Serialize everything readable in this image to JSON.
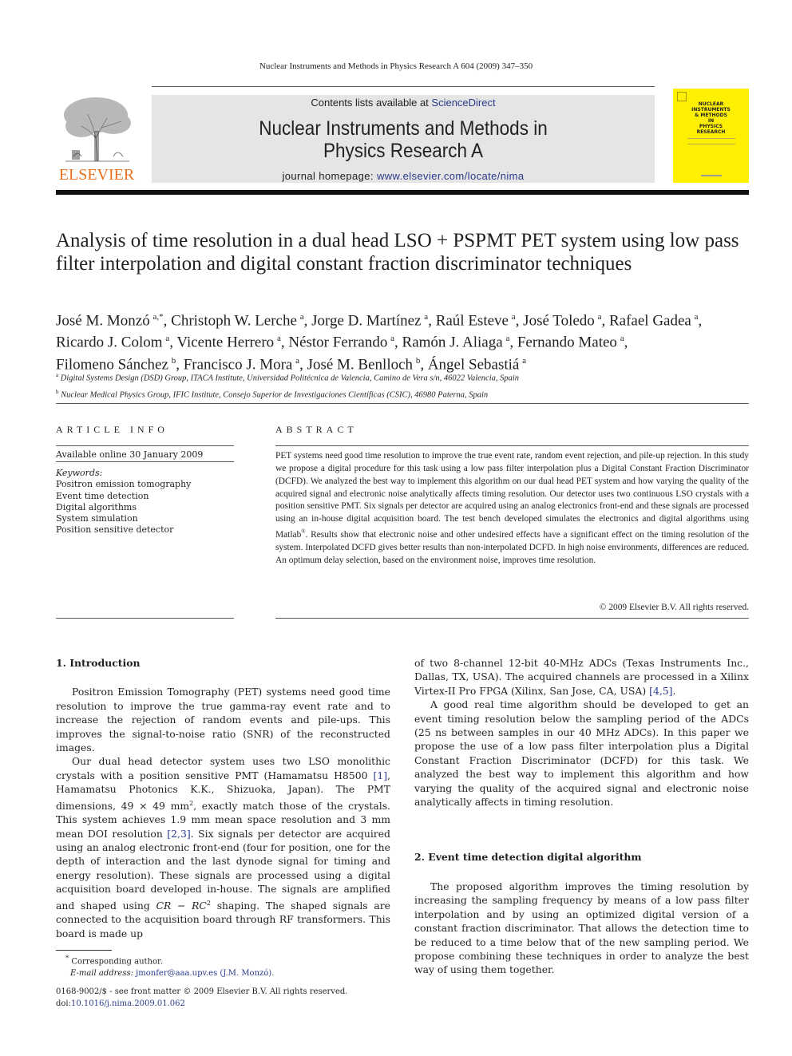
{
  "running_head": "Nuclear Instruments and Methods in Physics Research A 604 (2009) 347–350",
  "publisher": {
    "logo_text": "ELSEVIER",
    "brand_color": "#e9711c"
  },
  "banner": {
    "contents_prefix": "Contents lists available at ",
    "contents_link": "ScienceDirect",
    "journal_title_line1": "Nuclear Instruments and Methods in",
    "journal_title_line2": "Physics Research A",
    "homepage_prefix": "journal homepage: ",
    "homepage_link": "www.elsevier.com/locate/nima",
    "link_color": "#2a3a8c",
    "background": "#e5e5e5"
  },
  "cover": {
    "title_lines": [
      "NUCLEAR",
      "INSTRUMENTS",
      "& METHODS",
      "IN",
      "PHYSICS",
      "RESEARCH"
    ],
    "color": "#ffef00"
  },
  "article": {
    "title": "Analysis of time resolution in a dual head LSO + PSPMT PET system using low pass filter interpolation and digital constant fraction discriminator techniques",
    "authors": [
      {
        "name": "José M. Monzó",
        "aff": "a,*"
      },
      {
        "name": "Christoph W. Lerche",
        "aff": "a"
      },
      {
        "name": "Jorge D. Martínez",
        "aff": "a"
      },
      {
        "name": "Raúl Esteve",
        "aff": "a"
      },
      {
        "name": "José Toledo",
        "aff": "a"
      },
      {
        "name": "Rafael Gadea",
        "aff": "a"
      },
      {
        "name": "Ricardo J. Colom",
        "aff": "a"
      },
      {
        "name": "Vicente Herrero",
        "aff": "a"
      },
      {
        "name": "Néstor Ferrando",
        "aff": "a"
      },
      {
        "name": "Ramón J. Aliaga",
        "aff": "a"
      },
      {
        "name": "Fernando Mateo",
        "aff": "a"
      },
      {
        "name": "Filomeno Sánchez",
        "aff": "b"
      },
      {
        "name": "Francisco J. Mora",
        "aff": "a"
      },
      {
        "name": "José M. Benlloch",
        "aff": "b"
      },
      {
        "name": "Ángel Sebastiá",
        "aff": "a"
      }
    ],
    "affiliations": [
      {
        "key": "a",
        "text": "Digital Systems Design (DSD) Group, ITACA Institute, Universidad Politécnica de Valencia, Camino de Vera s/n, 46022 Valencia, Spain"
      },
      {
        "key": "b",
        "text": "Nuclear Medical Physics Group, IFIC Institute, Consejo Superior de Investigaciones Científicas (CSIC), 46980 Paterna, Spain"
      }
    ]
  },
  "article_info": {
    "heading": "ARTICLE INFO",
    "available": "Available online 30 January 2009",
    "keywords_label": "Keywords:",
    "keywords": [
      "Positron emission tomography",
      "Event time detection",
      "Digital algorithms",
      "System simulation",
      "Position sensitive detector"
    ]
  },
  "abstract": {
    "heading": "ABSTRACT",
    "text_before_sup": "PET systems need good time resolution to improve the true event rate, random event rejection, and pile-up rejection. In this study we propose a digital procedure for this task using a low pass filter interpolation plus a Digital Constant Fraction Discriminator (DCFD). We analyzed the best way to implement this algorithm on our dual head PET system and how varying the quality of the acquired signal and electronic noise analytically affects timing resolution. Our detector uses two continuous LSO crystals with a position sensitive PMT. Six signals per detector are acquired using an analog electronics front-end and these signals are processed using an in-house digital acquisition board. The test bench developed simulates the electronics and digital algorithms using Matlab",
    "sup": "®",
    "text_after_sup": ". Results show that electronic noise and other undesired effects have a significant effect on the timing resolution of the system. Interpolated DCFD gives better results than non-interpolated DCFD. In high noise environments, differences are reduced. An optimum delay selection, based on the environment noise, improves time resolution.",
    "copyright": "© 2009 Elsevier B.V. All rights reserved."
  },
  "body": {
    "sec1_title": "1.  Introduction",
    "sec1_p1": "Positron Emission Tomography (PET) systems need good time resolution to improve the true gamma-ray event rate and to increase the rejection of random events and pile-ups. This improves the signal-to-noise ratio (SNR) of the reconstructed images.",
    "sec1_p2_a": "Our dual head detector system uses two LSO monolithic crystals with a position sensitive PMT (Hamamatsu H8500 ",
    "sec1_p2_ref1": "[1]",
    "sec1_p2_b": ", Hamamatsu Photonics K.K., Shizuoka, Japan). The PMT dimensions, 49 × 49 mm",
    "sec1_p2_sup": "2",
    "sec1_p2_c": ", exactly match those of the crystals. This system achieves 1.9 mm mean space resolution and 3 mm mean DOI resolution ",
    "sec1_p2_ref2": "[2,3]",
    "sec1_p2_d": ". Six signals per detector are acquired using an analog electronic front-end (four for position, one for the depth of interaction and the last dynode signal for timing and energy resolution). These signals are processed using a digital acquisition board developed in-house. The signals are amplified and shaped using ",
    "sec1_p2_math": "CR − RC",
    "sec1_p2_math_sup": "2",
    "sec1_p2_e": " shaping. The shaped signals are connected to the acquisition board through RF transformers. This board is made up",
    "right_p1_a": "of two 8-channel 12-bit 40-MHz ADCs (Texas Instruments Inc., Dallas, TX, USA). The acquired channels are processed in a Xilinx Virtex-II Pro FPGA (Xilinx, San Jose, CA, USA) ",
    "right_p1_ref": "[4,5]",
    "right_p1_b": ".",
    "right_p2": "A good real time algorithm should be developed to get an event timing resolution below the sampling period of the ADCs (25 ns between samples in our 40 MHz ADCs). In this paper we propose the use of a low pass filter interpolation plus a Digital Constant Fraction Discriminator (DCFD) for this task. We analyzed the best way to implement this algorithm and how varying the quality of the acquired signal and electronic noise analytically affects in timing resolution.",
    "sec2_title": "2.  Event time detection digital algorithm",
    "sec2_p1": "The proposed algorithm improves the timing resolution by increasing the sampling frequency by means of a low pass filter interpolation and by using an optimized digital version of a constant fraction discriminator. That allows the detection time to be reduced to a time below that of the new sampling period. We propose combining these techniques in order to analyze the best way of using them together."
  },
  "footnote": {
    "star": "*",
    "corresponding": "Corresponding author.",
    "email_label": "E-mail address: ",
    "email": "jmonfer@aaa.upv.es",
    "email_owner": "(J.M. Monzó)."
  },
  "front_matter": {
    "line1": "0168-9002/$ - see front matter © 2009 Elsevier B.V. All rights reserved.",
    "doi_label": "doi:",
    "doi": "10.1016/j.nima.2009.01.062"
  }
}
